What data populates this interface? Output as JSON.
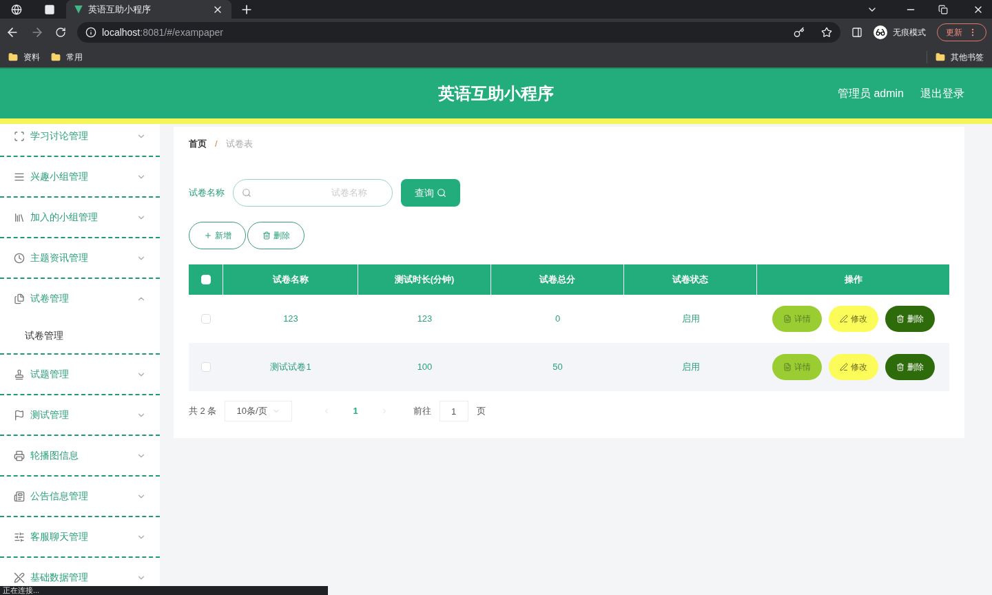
{
  "browser": {
    "tab_title": "英语互助小程序",
    "url_host": "localhost",
    "url_rest": ":8081/#/exampaper",
    "incognito_label": "无痕模式",
    "update_label": "更新",
    "bookmarks": [
      "资料",
      "常用"
    ],
    "other_bookmarks": "其他书签",
    "status_text": "正在连接..."
  },
  "header": {
    "title": "英语互助小程序",
    "user": "管理员 admin",
    "logout": "退出登录"
  },
  "sidebar": {
    "items": [
      {
        "label": "学习讨论管理",
        "expanded": false
      },
      {
        "label": "兴趣小组管理",
        "expanded": false
      },
      {
        "label": "加入的小组管理",
        "expanded": false
      },
      {
        "label": "主题资讯管理",
        "expanded": false
      },
      {
        "label": "试卷管理",
        "expanded": true,
        "children": [
          {
            "label": "试卷管理"
          }
        ]
      },
      {
        "label": "试题管理",
        "expanded": false
      },
      {
        "label": "测试管理",
        "expanded": false
      },
      {
        "label": "轮播图信息",
        "expanded": false
      },
      {
        "label": "公告信息管理",
        "expanded": false
      },
      {
        "label": "客服聊天管理",
        "expanded": false
      },
      {
        "label": "基础数据管理",
        "expanded": false
      }
    ]
  },
  "breadcrumb": [
    "首页",
    "/",
    "试卷表"
  ],
  "search": {
    "label": "试卷名称",
    "placeholder": "试卷名称",
    "button": "查询"
  },
  "actions": [
    "新增",
    "删除"
  ],
  "table": {
    "select_all_checked": false,
    "columns": [
      "试卷名称",
      "测试时长(分钟)",
      "试卷总分",
      "试卷状态",
      "操作"
    ],
    "rows": [
      {
        "checked": false,
        "cells": [
          "123",
          "123",
          "0",
          "启用"
        ],
        "buttons": [
          "详情",
          "修改",
          "删除"
        ]
      },
      {
        "checked": false,
        "cells": [
          "测试试卷1",
          "100",
          "50",
          "启用"
        ],
        "buttons": [
          "详情",
          "修改",
          "删除"
        ]
      }
    ]
  },
  "pagination": {
    "total": "共 2 条",
    "page_size": "10条/页",
    "current": "1",
    "goto_label": "前往",
    "goto_value": "1",
    "page_unit": "页"
  }
}
